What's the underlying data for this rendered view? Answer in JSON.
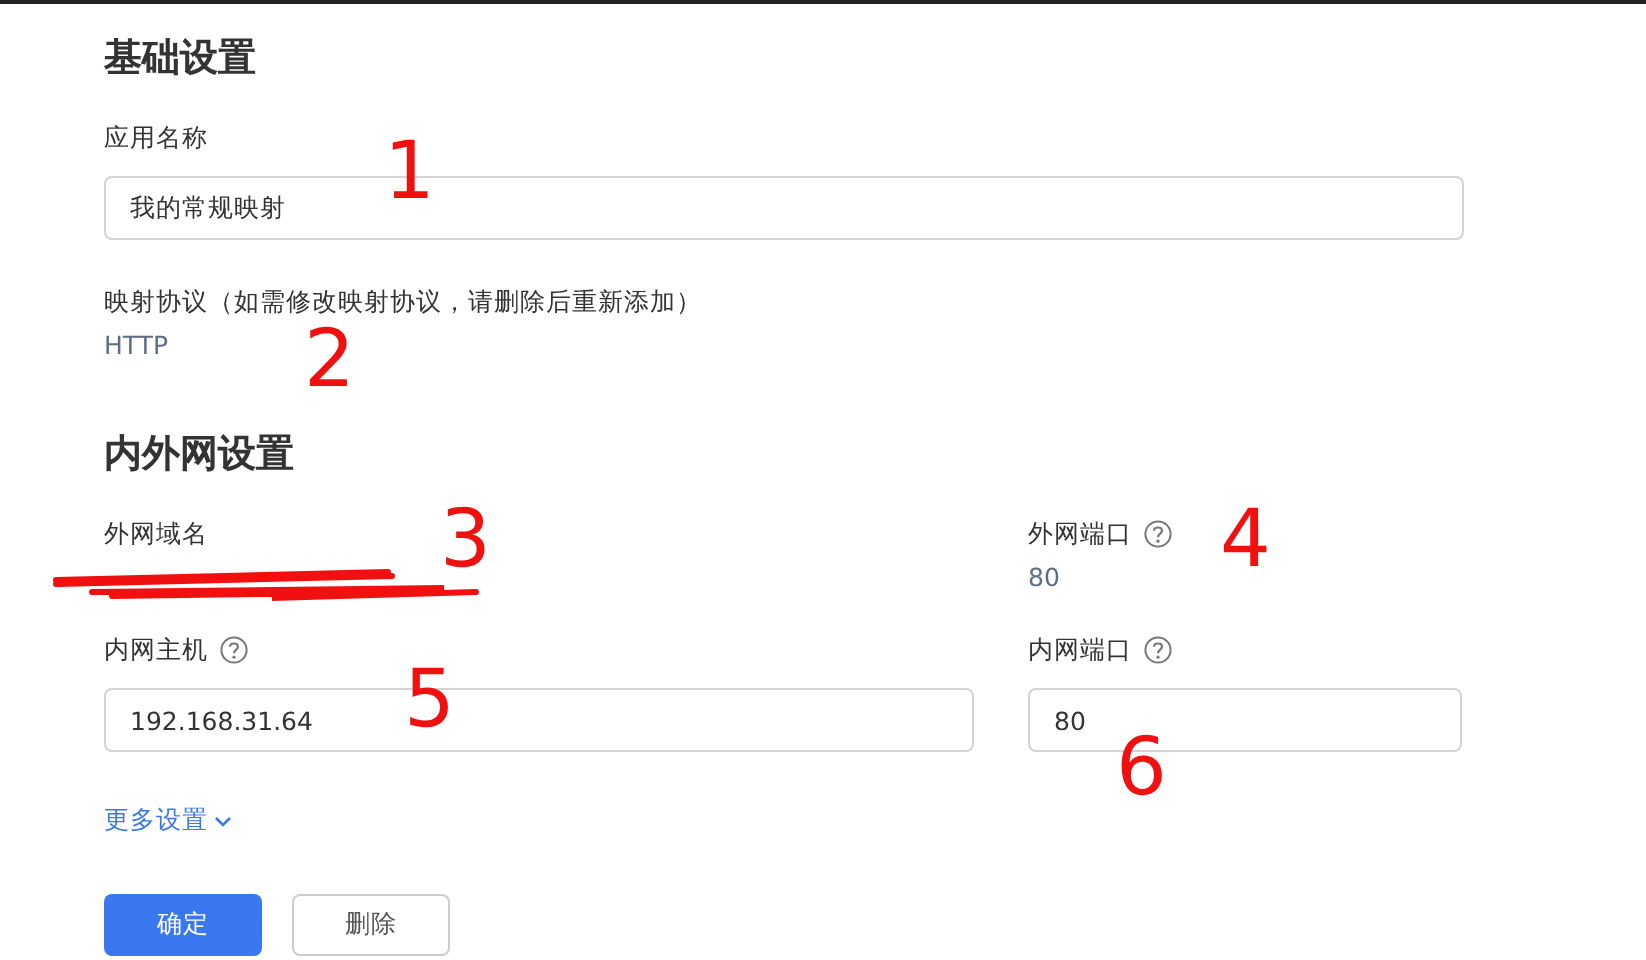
{
  "basic": {
    "title": "基础设置",
    "app_name": {
      "label": "应用名称",
      "value": "我的常规映射",
      "annotation": "1"
    },
    "protocol": {
      "label": "映射协议（如需修改映射协议，请删除后重新添加）",
      "value": "HTTP",
      "annotation": "2"
    }
  },
  "network": {
    "title": "内外网设置",
    "external_domain": {
      "label": "外网域名",
      "redacted": true,
      "annotation": "3"
    },
    "external_port": {
      "label": "外网端口",
      "help": true,
      "value": "80",
      "annotation": "4"
    },
    "internal_host": {
      "label": "内网主机",
      "help": true,
      "value": "192.168.31.64",
      "annotation": "5"
    },
    "internal_port": {
      "label": "内网端口",
      "help": true,
      "value": "80",
      "annotation": "6"
    }
  },
  "more_settings": {
    "label": "更多设置",
    "expanded": false
  },
  "buttons": [
    {
      "label": "确定",
      "kind": "primary"
    },
    {
      "label": "删除",
      "kind": "default"
    }
  ]
}
